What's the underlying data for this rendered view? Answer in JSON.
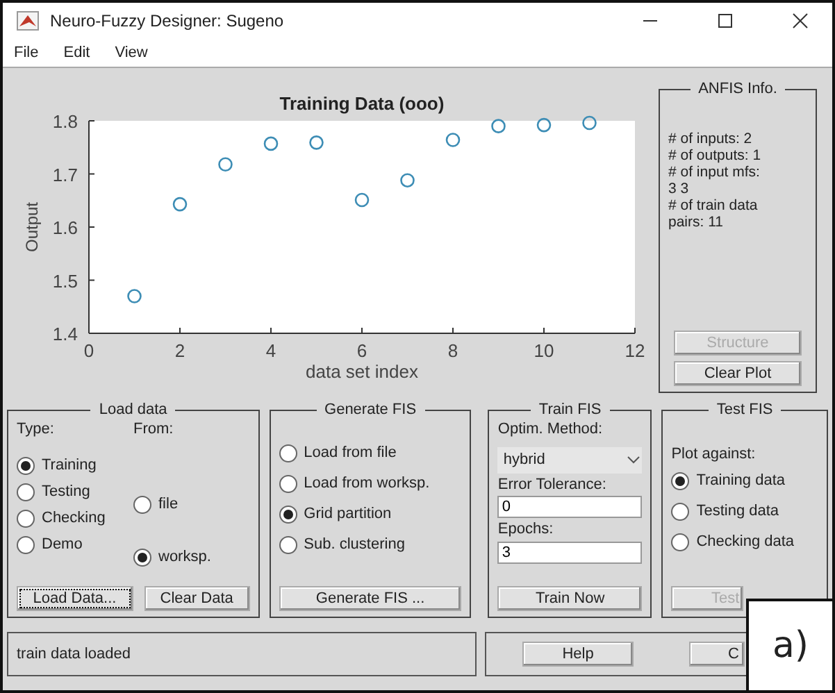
{
  "window": {
    "title": "Neuro-Fuzzy Designer: Sugeno"
  },
  "menu": [
    "File",
    "Edit",
    "View"
  ],
  "plot": {
    "chart_data": {
      "type": "scatter",
      "title": "Training Data (ooo)",
      "xlabel": "data set index",
      "ylabel": "Output",
      "x": [
        1,
        2,
        3,
        4,
        5,
        6,
        7,
        8,
        9,
        10,
        11
      ],
      "series": [
        {
          "color": "#3d8db5",
          "values": [
            1.47,
            1.643,
            1.718,
            1.757,
            1.759,
            1.651,
            1.688,
            1.764,
            1.79,
            1.792,
            1.796
          ]
        }
      ],
      "xlim": [
        0,
        12
      ],
      "ylim": [
        1.4,
        1.8
      ],
      "xticks": [
        0,
        2,
        4,
        6,
        8,
        10,
        12
      ],
      "yticks": [
        1.4,
        1.5,
        1.6,
        1.7,
        1.8
      ]
    }
  },
  "anfis_info": {
    "title": "ANFIS Info.",
    "lines": [
      "# of inputs: 2",
      "# of outputs: 1",
      "# of input mfs:",
      "3 3",
      "# of train data",
      "pairs: 11"
    ],
    "buttons": [
      {
        "label": "Structure",
        "disabled": true
      },
      {
        "label": "Clear Plot",
        "disabled": false
      }
    ]
  },
  "load_data": {
    "title": "Load data",
    "type_label": "Type:",
    "from_label": "From:",
    "types": [
      {
        "label": "Training",
        "selected": true
      },
      {
        "label": "Testing",
        "selected": false
      },
      {
        "label": "Checking",
        "selected": false
      },
      {
        "label": "Demo",
        "selected": false
      }
    ],
    "sources": [
      {
        "label": "file",
        "selected": false
      },
      {
        "label": "worksp.",
        "selected": true
      }
    ],
    "buttons": [
      {
        "label": "Load Data...",
        "focused": true
      },
      {
        "label": "Clear Data",
        "focused": false
      }
    ]
  },
  "generate_fis": {
    "title": "Generate FIS",
    "options": [
      {
        "label": "Load from file",
        "selected": false
      },
      {
        "label": "Load from worksp.",
        "selected": false
      },
      {
        "label": "Grid partition",
        "selected": true
      },
      {
        "label": "Sub. clustering",
        "selected": false
      }
    ],
    "button": "Generate FIS ..."
  },
  "train_fis": {
    "title": "Train FIS",
    "method_label": "Optim. Method:",
    "method": "hybrid",
    "tolerance_label": "Error Tolerance:",
    "tolerance": "0",
    "epochs_label": "Epochs:",
    "epochs": "3",
    "button": "Train Now"
  },
  "test_fis": {
    "title": "Test FIS",
    "plot_label": "Plot against:",
    "options": [
      {
        "label": "Training data",
        "selected": true
      },
      {
        "label": "Testing data",
        "selected": false
      },
      {
        "label": "Checking data",
        "selected": false
      }
    ],
    "button": {
      "label": "Test",
      "disabled": true
    }
  },
  "status": "train data loaded",
  "bottom_buttons": [
    "Help",
    "C"
  ],
  "figure_label": "a)"
}
